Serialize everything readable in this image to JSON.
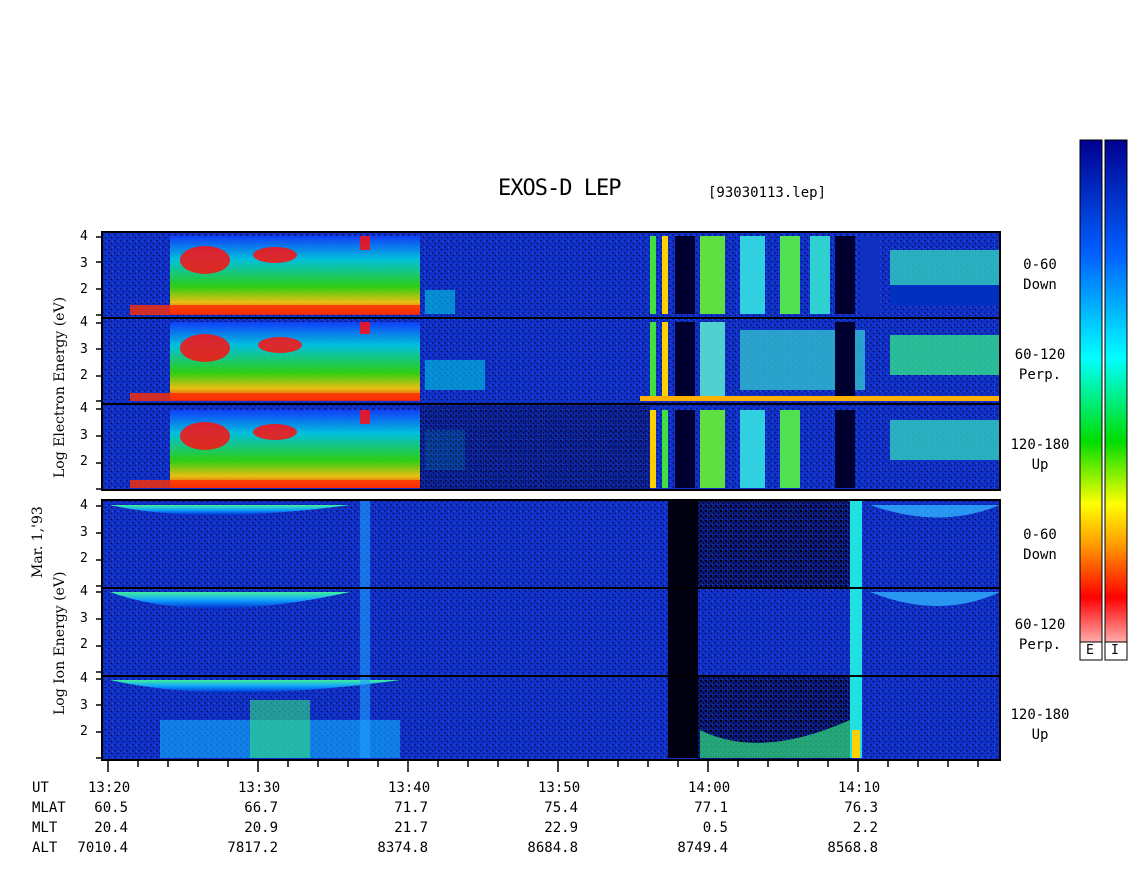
{
  "title": "EXOS-D LEP",
  "file": "[93030113.lep]",
  "date_label": "Mar. 1,'93",
  "electron_ylabel": "Log  Electron  Energy (eV)",
  "ion_ylabel": "Log  Ion  Energy (eV)",
  "yticks": [
    "4",
    "3",
    "2"
  ],
  "panels": [
    {
      "label1": "0-60",
      "label2": "Down"
    },
    {
      "label1": "60-120",
      "label2": "Perp."
    },
    {
      "label1": "120-180",
      "label2": "Up"
    },
    {
      "label1": "0-60",
      "label2": "Down"
    },
    {
      "label1": "60-120",
      "label2": "Perp."
    },
    {
      "label1": "120-180",
      "label2": "Up"
    }
  ],
  "colorbar_labels": [
    "E",
    "I"
  ],
  "rows": [
    {
      "name": "UT",
      "values": [
        "13:20",
        "13:30",
        "13:40",
        "13:50",
        "14:00",
        "14:10"
      ]
    },
    {
      "name": "MLAT",
      "values": [
        "60.5",
        "66.7",
        "71.7",
        "75.4",
        "77.1",
        "76.3"
      ]
    },
    {
      "name": "MLT",
      "values": [
        "20.4",
        "20.9",
        "21.7",
        "22.9",
        "0.5",
        "2.2"
      ]
    },
    {
      "name": "ALT",
      "values": [
        "7010.4",
        "7817.2",
        "8374.8",
        "8684.8",
        "8749.4",
        "8568.8"
      ]
    }
  ],
  "chart_data": {
    "type": "heatmap",
    "title": "EXOS-D LEP",
    "x_ticks": [
      "13:20",
      "13:30",
      "13:40",
      "13:50",
      "14:00",
      "14:10"
    ],
    "ylim": [
      1,
      4
    ],
    "y_ticks": [
      2,
      3,
      4
    ],
    "panels": [
      "Electron 0-60 Down",
      "Electron 60-120 Perp.",
      "Electron 120-180 Up",
      "Ion 0-60 Down",
      "Ion 60-120 Perp.",
      "Ion 120-180 Up"
    ],
    "colormap": [
      "#fff0f0",
      "#ff0000",
      "#ffaa00",
      "#ffff00",
      "#00dd00",
      "#00ffff",
      "#0040ff",
      "#0000a0"
    ]
  }
}
